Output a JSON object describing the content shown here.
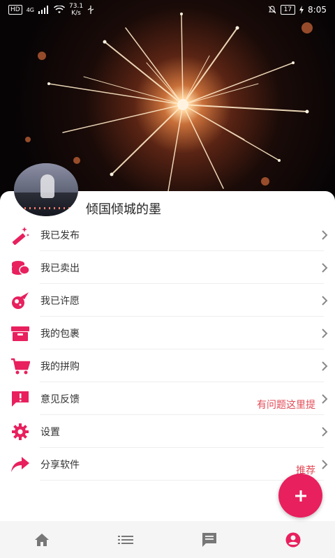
{
  "status_bar": {
    "hd": "HD",
    "signal_type": "4G",
    "net_speed_value": "73.1",
    "net_speed_unit": "K/s",
    "battery": "17",
    "time": "8:05"
  },
  "profile": {
    "username": "倾国倾城的墨"
  },
  "menu": {
    "items": [
      {
        "label": "我已发布",
        "icon": "magic-wand-icon",
        "hint": ""
      },
      {
        "label": "我已卖出",
        "icon": "coins-icon",
        "hint": ""
      },
      {
        "label": "我已许愿",
        "icon": "wish-meteor-icon",
        "hint": ""
      },
      {
        "label": "我的包裹",
        "icon": "package-box-icon",
        "hint": ""
      },
      {
        "label": "我的拼购",
        "icon": "shopping-cart-icon",
        "hint": ""
      },
      {
        "label": "意见反馈",
        "icon": "feedback-icon",
        "hint": "有问题这里提"
      },
      {
        "label": "设置",
        "icon": "settings-gear-icon",
        "hint": ""
      },
      {
        "label": "分享软件",
        "icon": "share-arrow-icon",
        "hint": "推荐"
      }
    ]
  },
  "fab": {
    "icon": "plus-icon"
  },
  "bottom_nav": {
    "items": [
      {
        "icon": "home-icon",
        "active": false
      },
      {
        "icon": "list-icon",
        "active": false
      },
      {
        "icon": "message-icon",
        "active": false
      },
      {
        "icon": "profile-icon",
        "active": true
      }
    ]
  },
  "colors": {
    "accent": "#e8205e",
    "hint_red": "#e24a56",
    "nav_inactive": "#777777",
    "nav_active": "#e8205e"
  }
}
